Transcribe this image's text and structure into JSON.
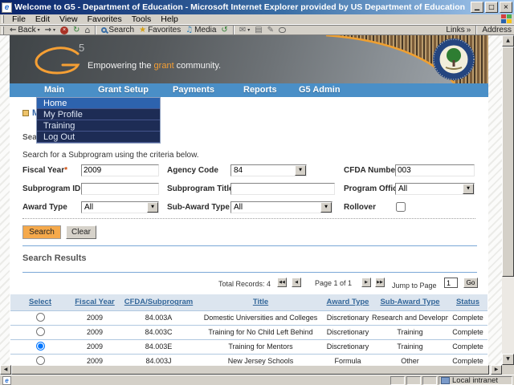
{
  "chrome": {
    "title": "Welcome to G5 - Department of Education - Microsoft Internet Explorer provided by US Department of Education",
    "menu_items": [
      "File",
      "Edit",
      "View",
      "Favorites",
      "Tools",
      "Help"
    ],
    "toolbar": {
      "back": "Back",
      "search": "Search",
      "favorites": "Favorites",
      "media": "Media",
      "links": "Links",
      "links_chevron": "»",
      "address": "Address"
    },
    "status": {
      "local_intranet": "Local intranet"
    }
  },
  "icons": {
    "minimize": "▁",
    "restore": "□",
    "close": "×",
    "back_arrow": "←",
    "forward_arrow": "→",
    "stop": "×",
    "refresh": "↻",
    "home": "⌂",
    "favorites_star": "★",
    "media_note": "♫",
    "history": "↺",
    "mail": "✉",
    "print": "▤",
    "edit": "✎",
    "dropdown": "▼",
    "pager_first": "◀◀",
    "pager_prev": "◀",
    "pager_next": "▶",
    "pager_last": "▶▶",
    "scroll_up": "▲",
    "scroll_down": "▼",
    "scroll_left": "◀",
    "scroll_right": "▶"
  },
  "banner": {
    "logo_five": "5",
    "tagline_pre": "Empowering the ",
    "tagline_accent": "grant",
    "tagline_post": " community."
  },
  "nav": {
    "items": [
      "Main",
      "Grant Setup",
      "Payments",
      "Reports",
      "G5 Admin"
    ]
  },
  "dropdown_menu": {
    "items": [
      "Home",
      "My Profile",
      "Training",
      "Log Out"
    ],
    "active_item": "Home"
  },
  "content": {
    "obscured_title": "M",
    "obscured_section": "Sear",
    "instructions": "Search for a Subprogram using the criteria below.",
    "form": {
      "fiscal_year": {
        "label": "Fiscal Year",
        "required_mark": "*",
        "value": "2009"
      },
      "agency_code": {
        "label": "Agency Code",
        "value": "84"
      },
      "cfda_number": {
        "label": "CFDA Number",
        "value": "003"
      },
      "subprogram_id": {
        "label": "Subprogram ID",
        "value": ""
      },
      "subprogram_title": {
        "label": "Subprogram Title",
        "value": ""
      },
      "program_office": {
        "label": "Program Office",
        "value": "All"
      },
      "award_type": {
        "label": "Award Type",
        "value": "All"
      },
      "sub_award_type": {
        "label": "Sub-Award Type",
        "value": "All"
      },
      "rollover": {
        "label": "Rollover",
        "checked": false
      }
    },
    "buttons": {
      "search": "Search",
      "clear": "Clear"
    },
    "results": {
      "heading": "Search Results",
      "total_label": "Total Records: 4",
      "page_info": "Page 1 of 1",
      "jump_label": "Jump to Page",
      "jump_value": "1",
      "go_label": "Go",
      "table": {
        "headers": [
          "Select",
          "Fiscal Year",
          "CFDA/Subprogram",
          "Title",
          "Award Type",
          "Sub-Award Type",
          "Status"
        ],
        "rows": [
          {
            "selected": false,
            "fiscal_year": "2009",
            "cfda": "84.003A",
            "title": "Domestic Universities and Colleges",
            "award_type": "Discretionary",
            "sub_award_type": "Research and Development",
            "status": "Complete"
          },
          {
            "selected": false,
            "fiscal_year": "2009",
            "cfda": "84.003C",
            "title": "Training for No Child Left Behind",
            "award_type": "Discretionary",
            "sub_award_type": "Training",
            "status": "Complete"
          },
          {
            "selected": true,
            "fiscal_year": "2009",
            "cfda": "84.003E",
            "title": "Training for Mentors",
            "award_type": "Discretionary",
            "sub_award_type": "Training",
            "status": "Complete"
          },
          {
            "selected": false,
            "fiscal_year": "2009",
            "cfda": "84.003J",
            "title": "New Jersey Schools",
            "award_type": "Formula",
            "sub_award_type": "Other",
            "status": "Complete"
          }
        ]
      }
    }
  },
  "colors": {
    "nav_blue": "#4a8fc7",
    "menu_dark": "#1d2c55",
    "menu_active": "#2d63ae",
    "accent_orange": "#f59f34",
    "link_blue": "#336699"
  }
}
